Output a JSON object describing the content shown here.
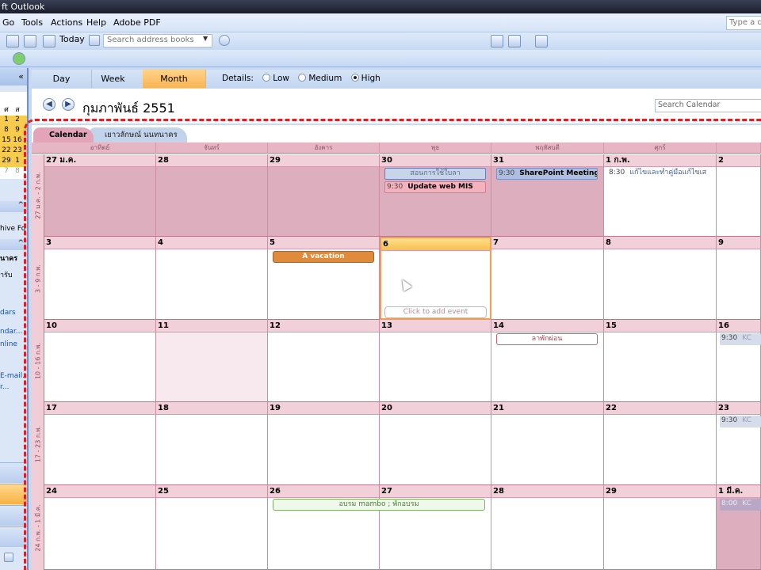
{
  "window": {
    "title": "ft Outlook"
  },
  "menu": {
    "items": [
      "Go",
      "Tools",
      "Actions",
      "Help",
      "Adobe PDF"
    ],
    "help_placeholder": "Type a qu"
  },
  "toolbar": {
    "today": "Today",
    "address_placeholder": "Search address books"
  },
  "nav": {
    "collapse": "«",
    "mini_cal_rows": [
      [
        "ศ",
        "ส"
      ],
      [
        "1",
        "2"
      ],
      [
        "8",
        "9"
      ],
      [
        "15",
        "16"
      ],
      [
        "22",
        "23"
      ],
      [
        "29",
        "1"
      ],
      [
        "7",
        "8"
      ]
    ],
    "texts": [
      "hive Fo",
      "นาคร",
      "ารับ",
      "dars",
      "ndar...",
      "nline",
      "E-mail...",
      "r..."
    ]
  },
  "views": {
    "tabs": [
      "Day",
      "Week",
      "Month"
    ],
    "active": "Month",
    "details_label": "Details:",
    "details": [
      "Low",
      "Medium",
      "High"
    ],
    "details_selected": "High"
  },
  "header": {
    "month_title": "กุมภาพันธ์ 2551",
    "search_placeholder": "Search Calendar"
  },
  "calendars": {
    "tabs": [
      "Calendar",
      "เยาวลักษณ์ นนทนาคร"
    ]
  },
  "weekdays": [
    "อาทิตย์",
    "จันทร์",
    "อังคาร",
    "พุธ",
    "พฤหัสบดี",
    "ศุกร์",
    ""
  ],
  "weeks": [
    {
      "label": "27 ม.ค. - 2 ก.พ.",
      "days": [
        "27 ม.ค.",
        "28",
        "29",
        "30",
        "31",
        "1 ก.พ.",
        "2"
      ]
    },
    {
      "label": "3 - 9 ก.พ.",
      "days": [
        "3",
        "4",
        "5",
        "6",
        "7",
        "8",
        "9"
      ]
    },
    {
      "label": "10 - 16 ก.พ.",
      "days": [
        "10",
        "11",
        "12",
        "13",
        "14",
        "15",
        "16"
      ]
    },
    {
      "label": "17 - 23 ก.พ.",
      "days": [
        "17",
        "18",
        "19",
        "20",
        "21",
        "22",
        "23"
      ]
    },
    {
      "label": "24 ก.พ. - 1 มี.ค.",
      "days": [
        "24",
        "25",
        "26",
        "27",
        "28",
        "29",
        "1 มี.ค."
      ]
    }
  ],
  "events": {
    "e1": "สอนการใช้ใบลา",
    "e2_time": "9:30",
    "e2": "Update web MIS",
    "e3_time": "9:30",
    "e3": "SharePoint Meeting; M",
    "e4_time": "8:30",
    "e4": "แก้ไขและทำคู่มือแก้ไขเส",
    "e5": "A vacation",
    "e6": "Click to add event",
    "e7_time": "9:30",
    "e7": "KC",
    "e8": "ลาพักผ่อน",
    "e9_time": "9:30",
    "e9": "KC",
    "e10": "อบรม mambo ; พักอบรม",
    "e11_time": "8:00",
    "e11": "KC"
  }
}
